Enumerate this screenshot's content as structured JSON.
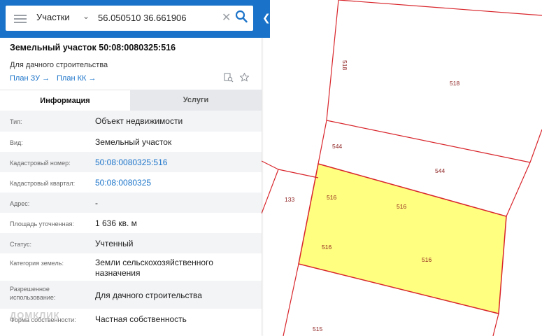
{
  "search": {
    "type_label": "Участки",
    "coords": "56.050510 36.661906"
  },
  "icons": {
    "menu": "hamburger-icon",
    "chevron": "chevron-down-icon",
    "clear": "close-icon",
    "search": "search-icon",
    "collapse": "chevron-left-icon",
    "doc_search": "document-search-icon",
    "favorite": "star-icon"
  },
  "parcel": {
    "title": "Земельный участок 50:08:0080325:516",
    "subtitle": "Для дачного строительства",
    "plan_zu": "План ЗУ →",
    "plan_kk": "План КК →"
  },
  "tabs": {
    "info": "Информация",
    "services": "Услуги"
  },
  "rows": [
    {
      "label": "Тип:",
      "value": "Объект недвижимости",
      "link": false
    },
    {
      "label": "Вид:",
      "value": "Земельный участок",
      "link": false
    },
    {
      "label": "Кадастровый номер:",
      "value": "50:08:0080325:516",
      "link": true
    },
    {
      "label": "Кадастровый квартал:",
      "value": "50:08:0080325",
      "link": true
    },
    {
      "label": "Адрес:",
      "value": "-",
      "link": false
    },
    {
      "label": "Площадь уточненная:",
      "value": "1 636 кв. м",
      "link": false
    },
    {
      "label": "Статус:",
      "value": "Учтенный",
      "link": false
    },
    {
      "label": "Категория земель:",
      "value": "Земли сельскохозяйственного назначения",
      "link": false
    },
    {
      "label": "Разрешенное использование:",
      "value": "Для дачного строительства",
      "link": false
    },
    {
      "label": "Форма собственности:",
      "value": "Частная собственность",
      "link": false
    }
  ],
  "map": {
    "labels": [
      "518",
      "518",
      "544",
      "544",
      "133",
      "516",
      "516",
      "516",
      "516",
      "515"
    ],
    "colors": {
      "boundary": "#d8252b",
      "highlight": "#ffff80",
      "label": "#8b1a1a"
    }
  },
  "watermark": "ДОМКЛИК"
}
